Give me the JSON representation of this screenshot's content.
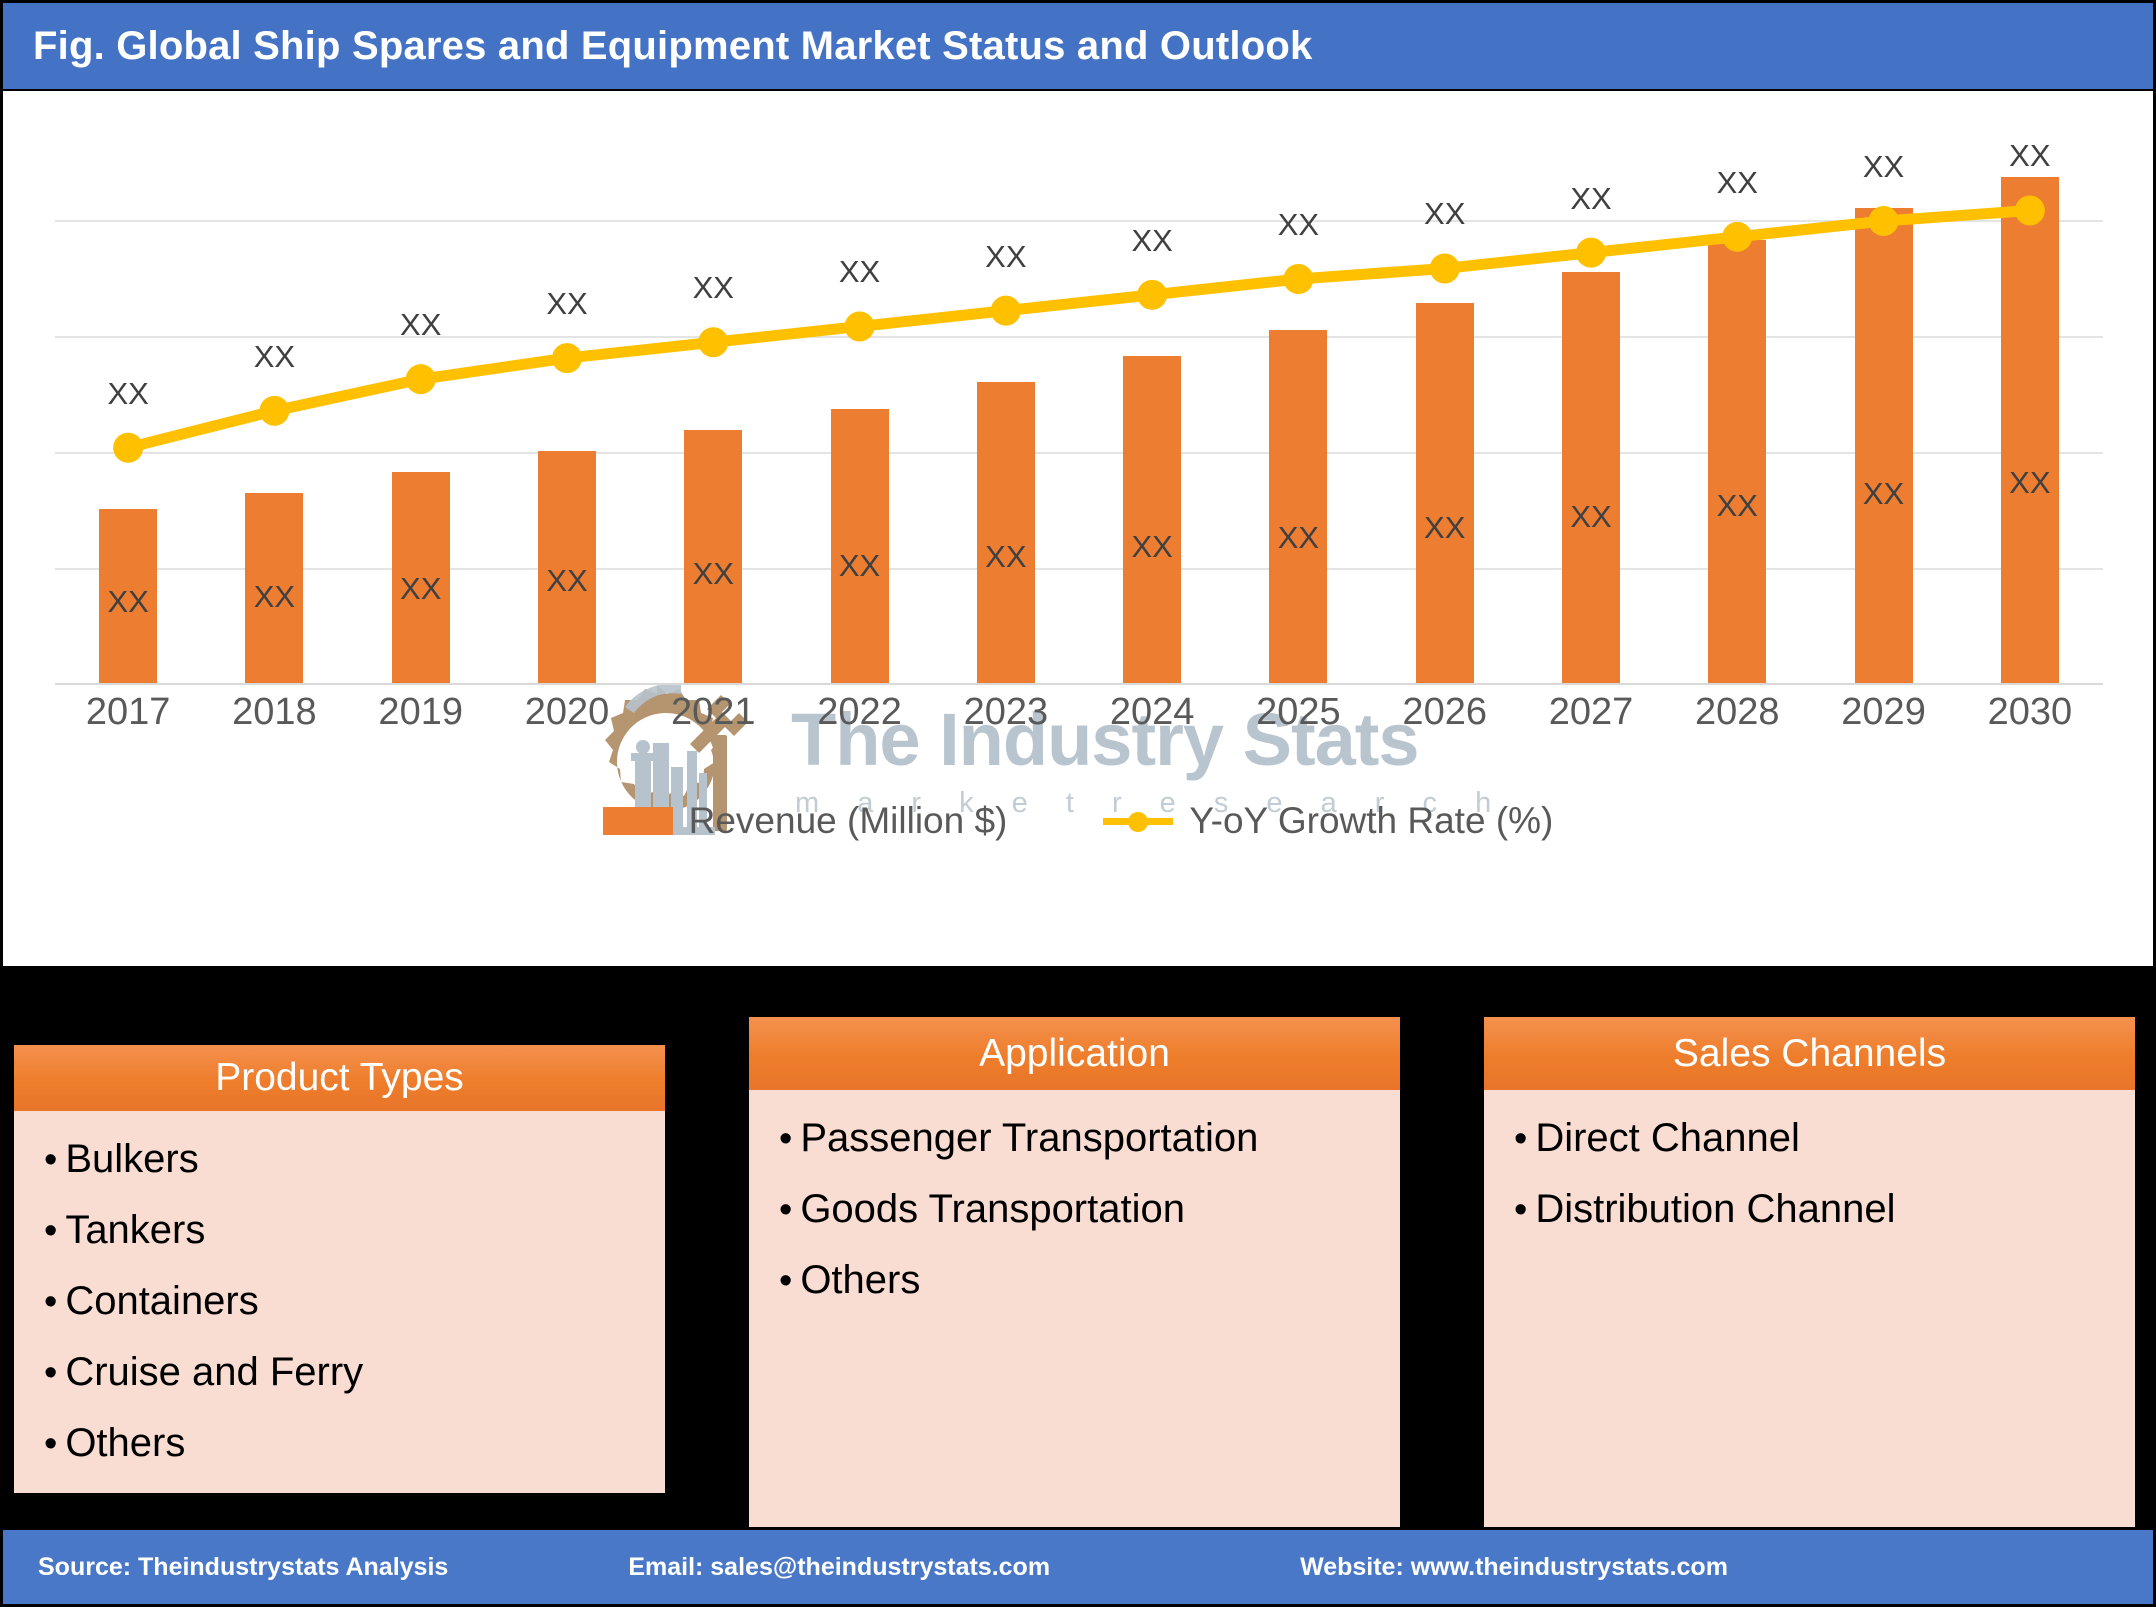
{
  "header": {
    "title": "Fig. Global Ship Spares and Equipment Market Status and Outlook"
  },
  "colors": {
    "title_bar": "#4472C4",
    "bar_series": "#ED7D31",
    "line_series": "#FFC000",
    "panel_header_from": "#F4914F",
    "panel_header_to": "#E8752A",
    "panel_body": "#F9DDD2",
    "footer_bar": "#4A78C8",
    "gridline": "#E4E4E4",
    "label_text": "#404040"
  },
  "watermark": {
    "brand": "The Industry Stats",
    "tagline": "m a r k e t    r e s e a r c h",
    "icon": "gear-wrench-factory-icon"
  },
  "chart_data": {
    "type": "bar",
    "title": "Fig. Global Ship Spares and Equipment Market Status and Outlook",
    "xlabel": "",
    "ylabel": "",
    "grid": true,
    "gridline_count": 4,
    "legend_position": "bottom",
    "categories": [
      "2017",
      "2018",
      "2019",
      "2020",
      "2021",
      "2022",
      "2023",
      "2024",
      "2025",
      "2026",
      "2027",
      "2028",
      "2029",
      "2030"
    ],
    "series": [
      {
        "name": "Revenue (Million $)",
        "type": "bar",
        "color": "#ED7D31",
        "axis": "left",
        "value_label": "XX",
        "values": [
          33,
          36,
          40,
          44,
          48,
          52,
          57,
          62,
          67,
          72,
          78,
          84,
          90,
          96
        ],
        "data_labels": [
          "XX",
          "XX",
          "XX",
          "XX",
          "XX",
          "XX",
          "XX",
          "XX",
          "XX",
          "XX",
          "XX",
          "XX",
          "XX",
          "XX"
        ]
      },
      {
        "name": "Y-oY Growth Rate (%)",
        "type": "line",
        "color": "#FFC000",
        "axis": "right",
        "value_label": "XX",
        "values": [
          45,
          52,
          58,
          62,
          65,
          68,
          71,
          74,
          77,
          79,
          82,
          85,
          88,
          90
        ],
        "data_labels": [
          "XX",
          "XX",
          "XX",
          "XX",
          "XX",
          "XX",
          "XX",
          "XX",
          "XX",
          "XX",
          "XX",
          "XX",
          "XX",
          "XX"
        ]
      }
    ],
    "ylim": [
      0,
      110
    ],
    "legend": [
      "Revenue (Million $)",
      "Y-oY Growth Rate (%)"
    ]
  },
  "legend": {
    "bar_label": "Revenue (Million $)",
    "line_label": "Y-oY Growth Rate (%)"
  },
  "panels": [
    {
      "heading": "Product Types",
      "items": [
        "Bulkers",
        "Tankers",
        "Containers",
        "Cruise and Ferry",
        "Others"
      ]
    },
    {
      "heading": "Application",
      "items": [
        "Passenger Transportation",
        "Goods Transportation",
        "Others"
      ]
    },
    {
      "heading": "Sales Channels",
      "items": [
        "Direct Channel",
        "Distribution Channel"
      ]
    }
  ],
  "footer": {
    "source": "Source: Theindustrystats Analysis",
    "email": "Email: sales@theindustrystats.com",
    "website": "Website: www.theindustrystats.com"
  }
}
